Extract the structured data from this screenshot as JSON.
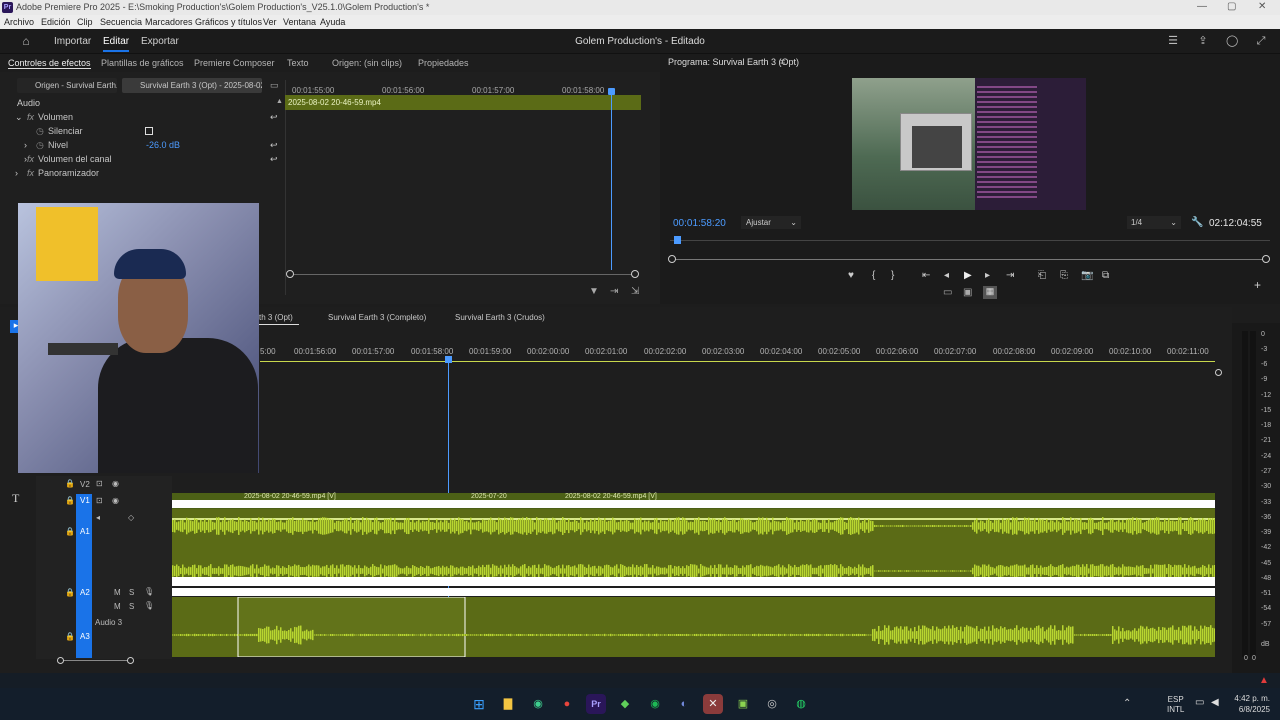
{
  "titlebar": {
    "title": "Adobe Premiere Pro 2025 - E:\\Smoking Production's\\Golem Production's_V25.1.0\\Golem Production's *"
  },
  "menu": [
    "Archivo",
    "Edición",
    "Clip",
    "Secuencia",
    "Marcadores",
    "Gráficos y títulos",
    "Ver",
    "Ventana",
    "Ayuda"
  ],
  "header": {
    "importar": "Importar",
    "editar": "Editar",
    "exportar": "Exportar",
    "project": "Golem Production's - Editado"
  },
  "panel_tabs": [
    "Controles de efectos",
    "Plantillas de gráficos",
    "Premiere Composer",
    "Texto",
    "Origen: (sin clips)",
    "Propiedades"
  ],
  "effect_controls": {
    "source_chip": "Origen - Survival Earth...",
    "seq_chip": "Survival Earth 3 (Opt) - 2025-08-02...",
    "section": "Audio",
    "volumen": "Volumen",
    "silenciar": "Silenciar",
    "nivel": "Nivel",
    "nivel_value": "-26.0 dB",
    "volumen_canal": "Volumen del canal",
    "panoramizador": "Panoramizador",
    "times": [
      "00:01:55:00",
      "00:01:56:00",
      "00:01:57:00",
      "00:01:58:00"
    ],
    "clip_name": "2025-08-02 20-46-59.mp4"
  },
  "program": {
    "title": "Programa: Survival Earth 3 (Opt)",
    "timecode": "00:01:58:20",
    "fit": "Ajustar",
    "resolution": "1/4",
    "duration": "02:12:04:55"
  },
  "sequence_tabs": [
    "th 3 (Opt)",
    "Survival Earth 3 (Completo)",
    "Survival Earth 3 (Crudos)"
  ],
  "ruler": [
    "5:00",
    "00:01:56:00",
    "00:01:57:00",
    "00:01:58:00",
    "00:01:59:00",
    "00:02:00:00",
    "00:02:01:00",
    "00:02:02:00",
    "00:02:03:00",
    "00:02:04:00",
    "00:02:05:00",
    "00:02:06:00",
    "00:02:07:00",
    "00:02:08:00",
    "00:02:09:00",
    "00:02:10:00",
    "00:02:11:00"
  ],
  "tracks": {
    "v2": "V2",
    "v1": "V1",
    "a1": "A1",
    "a2": "A2",
    "a3": "A3",
    "audio3": "Audio 3",
    "m": "M",
    "s": "S"
  },
  "clips": {
    "v1a": "2025-08-02 20-46-59.mp4 [V]",
    "v1b": "2025-07-20",
    "v1c": "2025-08-02 20-46-59.mp4 [V]"
  },
  "meter": [
    "0",
    "-3",
    "-6",
    "-9",
    "-12",
    "-15",
    "-18",
    "-21",
    "-24",
    "-27",
    "-30",
    "-33",
    "-36",
    "-39",
    "-42",
    "-45",
    "-48",
    "-51",
    "-54",
    "-57",
    "dB"
  ],
  "meter_bottom": [
    "0",
    "0"
  ],
  "taskbar": {
    "lang1": "ESP",
    "lang2": "INTL",
    "time": "4:42 p. m.",
    "date": "6/8/2025"
  },
  "colors": {
    "accent": "#1a73e8",
    "audio_wave": "#b8d630",
    "clip_bg": "#5b6b16",
    "timeline_blue": "#4c9bff"
  }
}
